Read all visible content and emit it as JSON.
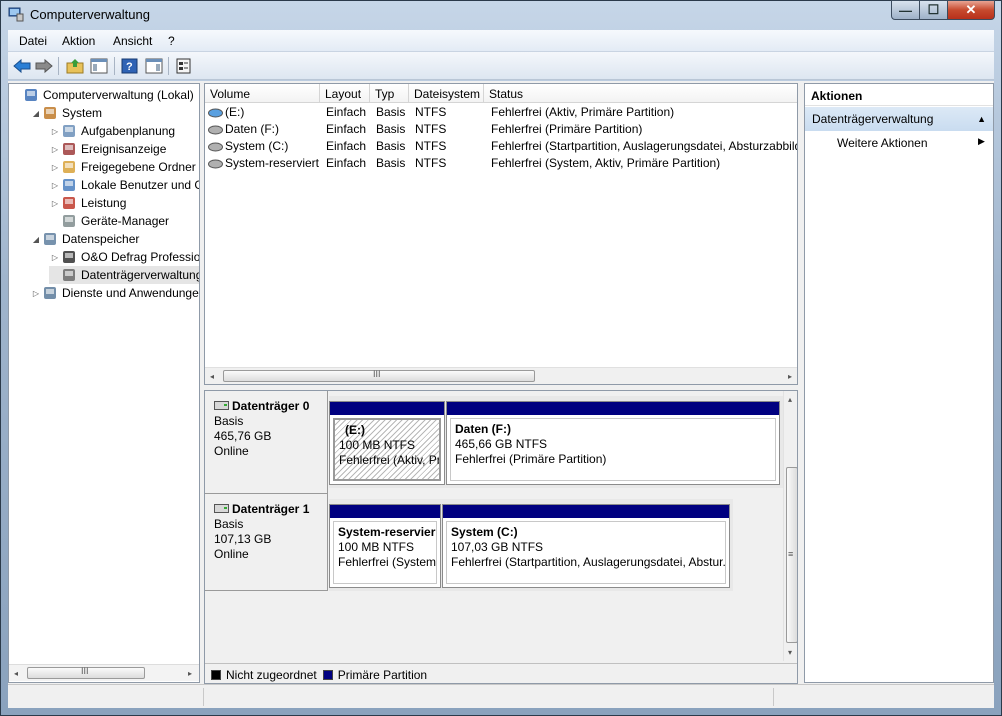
{
  "window": {
    "title": "Computerverwaltung",
    "min_glyph": "—",
    "max_glyph": "☐",
    "close_glyph": "✕"
  },
  "menu": [
    "Datei",
    "Aktion",
    "Ansicht",
    "?"
  ],
  "toolbar_icons": [
    "back-arrow-icon",
    "forward-arrow-icon",
    "up-folder-icon",
    "show-hide-tree-icon",
    "help-icon",
    "show-hide-action-pane-icon",
    "properties-icon"
  ],
  "tree": [
    {
      "label": "Computerverwaltung (Lokal)",
      "level": 0,
      "expander": "",
      "icon": "computer-management-icon"
    },
    {
      "label": "System",
      "level": 1,
      "expander": "◢",
      "icon": "system-tools-icon"
    },
    {
      "label": "Aufgabenplanung",
      "level": 2,
      "expander": "▷",
      "icon": "task-scheduler-icon"
    },
    {
      "label": "Ereignisanzeige",
      "level": 2,
      "expander": "▷",
      "icon": "event-viewer-icon"
    },
    {
      "label": "Freigegebene Ordner",
      "level": 2,
      "expander": "▷",
      "icon": "shared-folders-icon"
    },
    {
      "label": "Lokale Benutzer und Gr",
      "level": 2,
      "expander": "▷",
      "icon": "local-users-icon"
    },
    {
      "label": "Leistung",
      "level": 2,
      "expander": "▷",
      "icon": "performance-icon"
    },
    {
      "label": "Geräte-Manager",
      "level": 2,
      "expander": "",
      "icon": "device-manager-icon"
    },
    {
      "label": "Datenspeicher",
      "level": 1,
      "expander": "◢",
      "icon": "storage-icon"
    },
    {
      "label": "O&O Defrag Profession",
      "level": 2,
      "expander": "▷",
      "icon": "defrag-icon"
    },
    {
      "label": "Datenträgerverwaltung",
      "level": 2,
      "expander": "",
      "icon": "disk-management-icon",
      "selected": true
    },
    {
      "label": "Dienste und Anwendungen",
      "level": 1,
      "expander": "▷",
      "icon": "services-icon"
    }
  ],
  "volume_table": {
    "columns": [
      "Volume",
      "Layout",
      "Typ",
      "Dateisystem",
      "Status"
    ],
    "rows": [
      {
        "volume": "(E:)",
        "layout": "Einfach",
        "typ": "Basis",
        "fs": "NTFS",
        "status": "Fehlerfrei (Aktiv, Primäre Partition)",
        "icon": "blue-volume-icon"
      },
      {
        "volume": "Daten (F:)",
        "layout": "Einfach",
        "typ": "Basis",
        "fs": "NTFS",
        "status": "Fehlerfrei (Primäre Partition)",
        "icon": "volume-icon"
      },
      {
        "volume": "System (C:)",
        "layout": "Einfach",
        "typ": "Basis",
        "fs": "NTFS",
        "status": "Fehlerfrei (Startpartition, Auslagerungsdatei, Absturzabbild",
        "icon": "volume-icon"
      },
      {
        "volume": "System-reserviert",
        "layout": "Einfach",
        "typ": "Basis",
        "fs": "NTFS",
        "status": "Fehlerfrei (System, Aktiv, Primäre Partition)",
        "icon": "volume-icon"
      }
    ]
  },
  "disks": [
    {
      "name": "Datenträger 0",
      "type": "Basis",
      "size": "465,76 GB",
      "state": "Online",
      "partitions": [
        {
          "name": "(E:)",
          "size": "100 MB NTFS",
          "status": "Fehlerfrei (Aktiv, Pr",
          "hatched": true
        },
        {
          "name": "Daten  (F:)",
          "size": "465,66 GB NTFS",
          "status": "Fehlerfrei (Primäre Partition)",
          "hatched": false
        }
      ]
    },
    {
      "name": "Datenträger 1",
      "type": "Basis",
      "size": "107,13 GB",
      "state": "Online",
      "partitions": [
        {
          "name": "System-reservier",
          "size": "100 MB NTFS",
          "status": "Fehlerfrei (System,",
          "hatched": false
        },
        {
          "name": "System  (C:)",
          "size": "107,03 GB NTFS",
          "status": "Fehlerfrei (Startpartition, Auslagerungsdatei, Abstur.",
          "hatched": false
        }
      ]
    }
  ],
  "legend": [
    {
      "label": "Nicht zugeordnet",
      "color": "#000000"
    },
    {
      "label": "Primäre Partition",
      "color": "#000080"
    }
  ],
  "actions": {
    "header": "Aktionen",
    "section": "Datenträgerverwaltung",
    "more": "Weitere Aktionen"
  },
  "colors": {
    "primary_partition": "#000080",
    "selection": "#e5e5e5",
    "action_section_bg": "#cfe0f2"
  }
}
